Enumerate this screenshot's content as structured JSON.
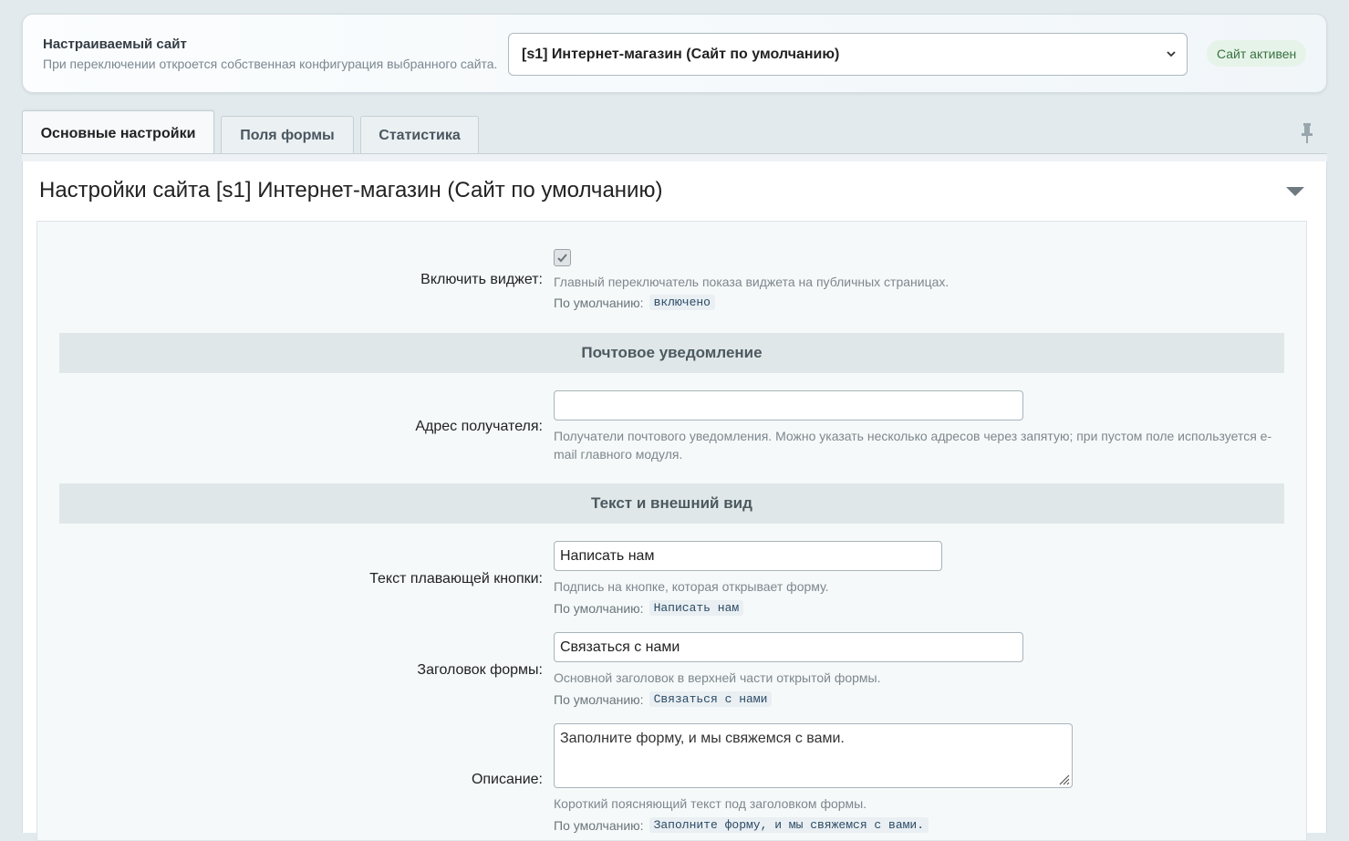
{
  "site_selector": {
    "title": "Настраиваемый сайт",
    "hint": "При переключении откроется собственная конфигурация выбранного сайта.",
    "selected_site": "[s1] Интернет-магазин (Сайт по умолчанию)",
    "status_badge": "Сайт активен"
  },
  "tabs": [
    {
      "label": "Основные настройки",
      "active": true
    },
    {
      "label": "Поля формы",
      "active": false
    },
    {
      "label": "Статистика",
      "active": false
    }
  ],
  "panel": {
    "title": "Настройки сайта [s1] Интернет-магазин (Сайт по умолчанию)"
  },
  "fields": {
    "enable_widget": {
      "label": "Включить виджет:",
      "checked": true,
      "description": "Главный переключатель показа виджета на публичных страницах.",
      "default_label": "По умолчанию:",
      "default_value": "включено"
    },
    "recipient": {
      "label": "Адрес получателя:",
      "value": "",
      "description": "Получатели почтового уведомления. Можно указать несколько адресов через запятую; при пустом поле используется e-mail главного модуля."
    },
    "button_text": {
      "label": "Текст плавающей кнопки:",
      "value": "Написать нам",
      "description": "Подпись на кнопке, которая открывает форму.",
      "default_label": "По умолчанию:",
      "default_value": "Написать нам"
    },
    "form_title": {
      "label": "Заголовок формы:",
      "value": "Связаться с нами",
      "description": "Основной заголовок в верхней части открытой формы.",
      "default_label": "По умолчанию:",
      "default_value": "Связаться с нами"
    },
    "description": {
      "label": "Описание:",
      "value": "Заполните форму, и мы свяжемся с вами.",
      "description": "Короткий поясняющий текст под заголовком формы.",
      "default_label": "По умолчанию:",
      "default_value": "Заполните форму, и мы свяжемся с вами."
    }
  },
  "sections": {
    "mail": "Почтовое уведомление",
    "appearance": "Текст и внешний вид"
  },
  "colors": {
    "page_bg": "#e2eaed",
    "badge_bg": "#e6f3e9",
    "badge_text": "#37723f",
    "section_bg": "#e0e7e9"
  }
}
